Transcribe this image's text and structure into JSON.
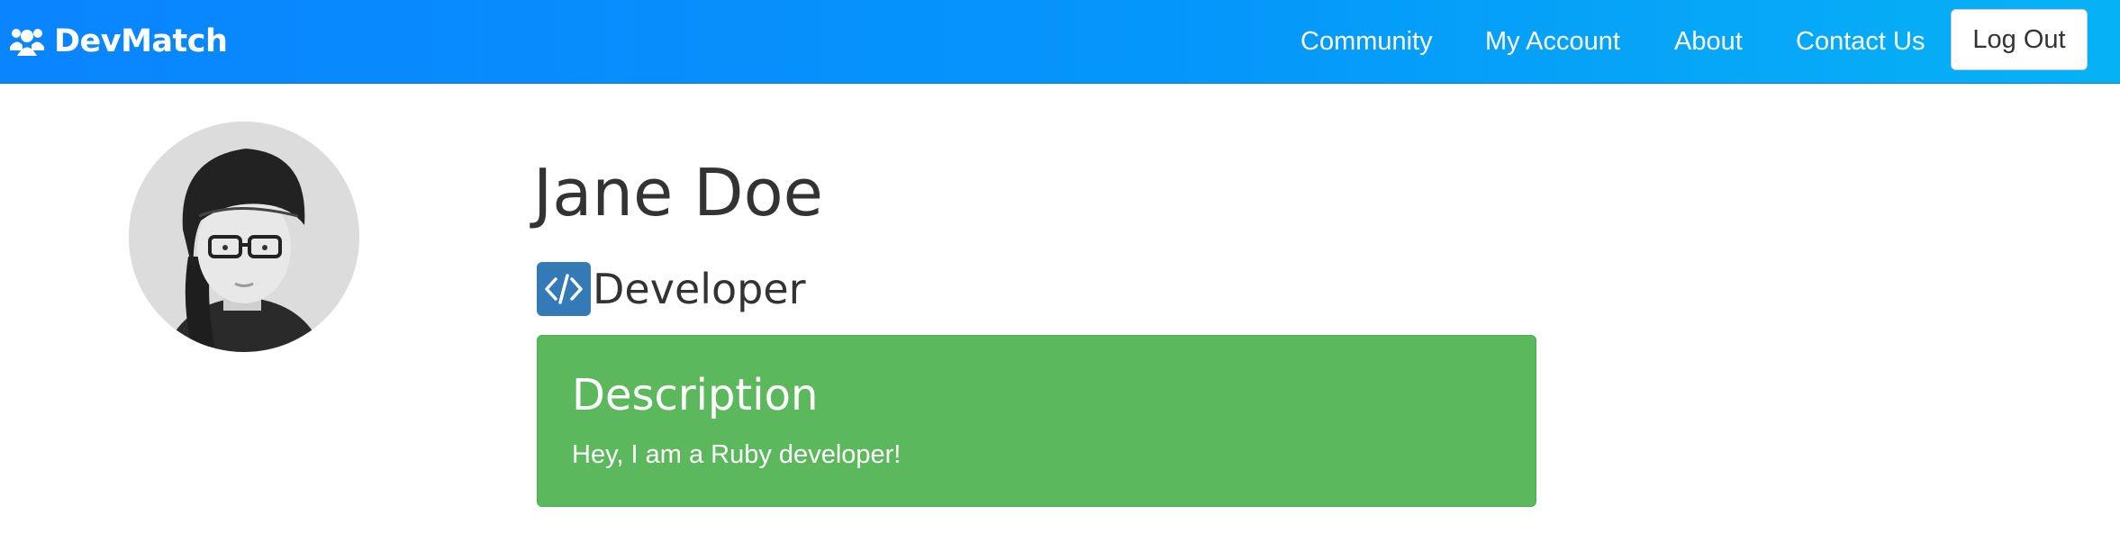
{
  "navbar": {
    "brand": "DevMatch",
    "brand_icon": "users-icon",
    "links": [
      "Community",
      "My Account",
      "About",
      "Contact Us"
    ],
    "logout_label": "Log Out",
    "colors": {
      "gradient_start": "#0a84ff",
      "gradient_end": "#06b2f5"
    }
  },
  "profile": {
    "name": "Jane Doe",
    "role": "Developer",
    "role_icon": "code-icon",
    "avatar_icon": "profile-photo",
    "description_title": "Description",
    "description_text": "Hey, I am a Ruby developer!",
    "colors": {
      "panel": "#5cb85c",
      "role_badge": "#337ab7"
    }
  }
}
